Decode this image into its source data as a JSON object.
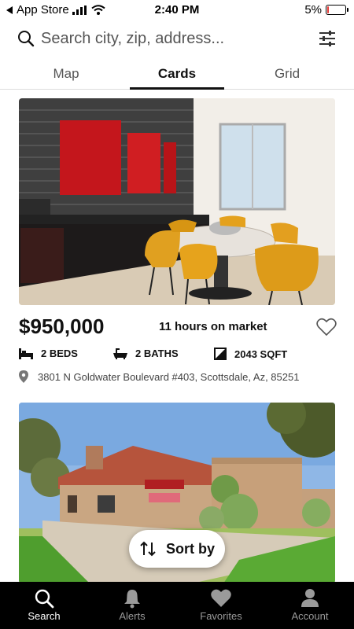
{
  "status_bar": {
    "back_label": "App Store",
    "time": "2:40 PM",
    "battery_percent": "5%",
    "battery_level": 0.05
  },
  "search": {
    "placeholder": "Search city, zip, address..."
  },
  "view_tabs": [
    {
      "label": "Map",
      "active": false
    },
    {
      "label": "Cards",
      "active": true
    },
    {
      "label": "Grid",
      "active": false
    }
  ],
  "listing": {
    "price": "$950,000",
    "time_on_market": "11 hours on market",
    "beds": "2 BEDS",
    "baths": "2 BATHS",
    "sqft": "2043 SQFT",
    "address": "3801 N Goldwater Boulevard #403, Scottsdale, Az, 85251"
  },
  "sort_button": {
    "label": "Sort by"
  },
  "bottom_nav": [
    {
      "label": "Search",
      "icon": "search-icon",
      "active": true
    },
    {
      "label": "Alerts",
      "icon": "bell-icon",
      "active": false
    },
    {
      "label": "Favorites",
      "icon": "heart-icon",
      "active": false
    },
    {
      "label": "Account",
      "icon": "person-icon",
      "active": false
    }
  ],
  "colors": {
    "accent": "#111111",
    "nav_background": "#000000",
    "battery_low": "#e53935"
  }
}
